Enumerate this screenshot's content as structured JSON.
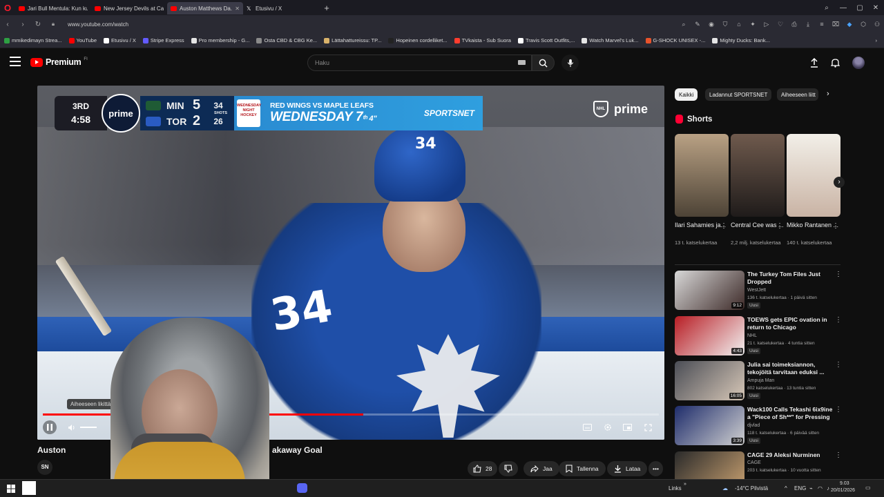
{
  "browser": {
    "tabs": [
      {
        "label": "Jari Bull Mentula: Kun ku..."
      },
      {
        "label": "New Jersey Devils at Calg..."
      },
      {
        "label": "Auston Matthews Da..."
      },
      {
        "label": "Etusivu / X"
      }
    ],
    "url": "www.youtube.com/watch",
    "bookmarks": [
      {
        "label": "mmikedimayn Strea...",
        "color": "#2ea043"
      },
      {
        "label": "YouTube",
        "color": "#ff0000"
      },
      {
        "label": "Etusivu / X",
        "color": "#ffffff"
      },
      {
        "label": "Stripe Express",
        "color": "#635bff"
      },
      {
        "label": "Pro membership - G...",
        "color": "#e5e5e5"
      },
      {
        "label": "Osta CBD & CBG Ke...",
        "color": "#8a8a8a"
      },
      {
        "label": "Lättahattureissu: TP...",
        "color": "#d9b26a"
      },
      {
        "label": "Hopeinen cordelliket...",
        "color": "#222222"
      },
      {
        "label": "TVkaista - Sub Suora",
        "color": "#ff3d2e"
      },
      {
        "label": "Travis Scott Outfits,...",
        "color": "#ffffff"
      },
      {
        "label": "Watch Marvel's Luk...",
        "color": "#e5e5e5"
      },
      {
        "label": "G-SHOCK UNISEX -...",
        "color": "#e8532b"
      },
      {
        "label": "Mighty Ducks: Bank...",
        "color": "#e5e5e5"
      }
    ]
  },
  "youtube": {
    "logo_text": "Premium",
    "country": "FI",
    "search_placeholder": "Haku"
  },
  "scorebug": {
    "period": "3RD",
    "clock": "4:58",
    "prime_label": "prime",
    "teams": [
      {
        "abbr": "MIN",
        "score": "5",
        "shots": "34",
        "color": "#1f5b35"
      },
      {
        "abbr": "TOR",
        "score": "2",
        "shots": "26",
        "color": "#1c4aa0"
      }
    ],
    "shots_label": "SHOTS",
    "promo_badge": "WEDNESDAY NIGHT HOCKEY",
    "matchup": "RED WINGS VS MAPLE LEAFS",
    "day": "WEDNESDAY 7",
    "time_suffix": "ᵗʰ 4\"",
    "network": "SPORTSNET",
    "nhl_label": "NHL",
    "watermark": "prime"
  },
  "player": {
    "progress": 0.52,
    "tooltip": "Aiheeseen likittä",
    "jersey_number": "34"
  },
  "video": {
    "title_left": "Auston ",
    "title_right": "akaway Goal",
    "channel_initials": "SN",
    "likes": "28",
    "share": "Jaa",
    "save": "Tallenna",
    "download": "Lataa"
  },
  "sidebar": {
    "chips": [
      {
        "label": "Kaikki"
      },
      {
        "label": "Ladannut SPORTSNET"
      },
      {
        "label": "Aiheeseen liitt"
      }
    ],
    "shorts_heading": "Shorts",
    "shorts": [
      {
        "title": "Ilari Sahamies ja...",
        "views": "13 t. katselukertaa",
        "color1": "#b9a184",
        "color2": "#4d4336"
      },
      {
        "title": "Central Cee was ...",
        "views": "2,2 milj. katselukertaa",
        "color1": "#6f5a4d",
        "color2": "#1f1b1a"
      },
      {
        "title": "Mikko Rantanen ...",
        "views": "140 t. katselukertaa",
        "color1": "#f2efe8",
        "color2": "#c9b3a4"
      }
    ],
    "recommendations": [
      {
        "title": "The Turkey Tom Files Just Dropped",
        "channel": "WestJett",
        "meta": "136 t. katselukertaa · 1 päivä sitten",
        "duration": "9:12",
        "badge": "Uusi",
        "color1": "#d8d8d8",
        "color2": "#3d2a28"
      },
      {
        "title": "TOEWS gets EPIC ovation in return to Chicago",
        "channel": "NHL",
        "meta": "21 t. katselukertaa · 4 tuntia sitten",
        "duration": "4:43",
        "badge": "Uusi",
        "color1": "#b81d24",
        "color2": "#f2f2f2"
      },
      {
        "title": "Julia sai toimeksiannon, tekojöitä tarvitaan eduksi ...",
        "channel": "Ampuja Man",
        "meta": "802 katselukertaa · 13 tuntia sitten",
        "duration": "16:05",
        "badge": "Uusi",
        "color1": "#4a4d55",
        "color2": "#d8c8b8"
      },
      {
        "title": "Wack100 Calls Tekashi 6ix9ine a \"Piece of Sh**\" for Pressing ...",
        "channel": "djvlad",
        "meta": "118 t. katselukertaa · 6 päivää sitten",
        "duration": "3:39",
        "badge": "Uusi",
        "color1": "#1e2c6b",
        "color2": "#d0d0d0"
      },
      {
        "title": "CAGE 29 Aleksi Nurminen",
        "channel": "CAGE",
        "meta": "203 t. katselukertaa · 10 vuotta sitten",
        "duration": "",
        "badge": "",
        "color1": "#2a2a2a",
        "color2": "#c8a070"
      }
    ]
  },
  "taskbar": {
    "links": "Links",
    "weather": "-14°C  Pilvistä",
    "lang": "ENG",
    "time": "9.03",
    "date": "20/01/2026"
  }
}
